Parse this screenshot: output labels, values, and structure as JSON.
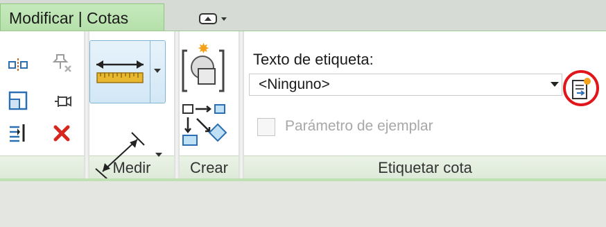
{
  "tabs": {
    "active_label": "Modificar | Cotas",
    "panel_dropdown_icon": "panel-display-dropdown-icon"
  },
  "panels": {
    "modify": {
      "title": ""
    },
    "measure": {
      "title": "Medir"
    },
    "create": {
      "title": "Crear"
    },
    "tag_dimension": {
      "title": "Etiquetar cota"
    }
  },
  "tag_dimension": {
    "label_text": "Texto de etiqueta:",
    "combo_value": "<Ninguno>",
    "instance_param_label": "Parámetro de ejemplar",
    "instance_param_checked": false,
    "instance_param_enabled": false
  },
  "colors": {
    "active_tab": "#b8e2ad",
    "panel_title_bg": "#e2eedd",
    "highlight_ring": "#e0161a",
    "button_hover_border": "#80b5d6"
  }
}
